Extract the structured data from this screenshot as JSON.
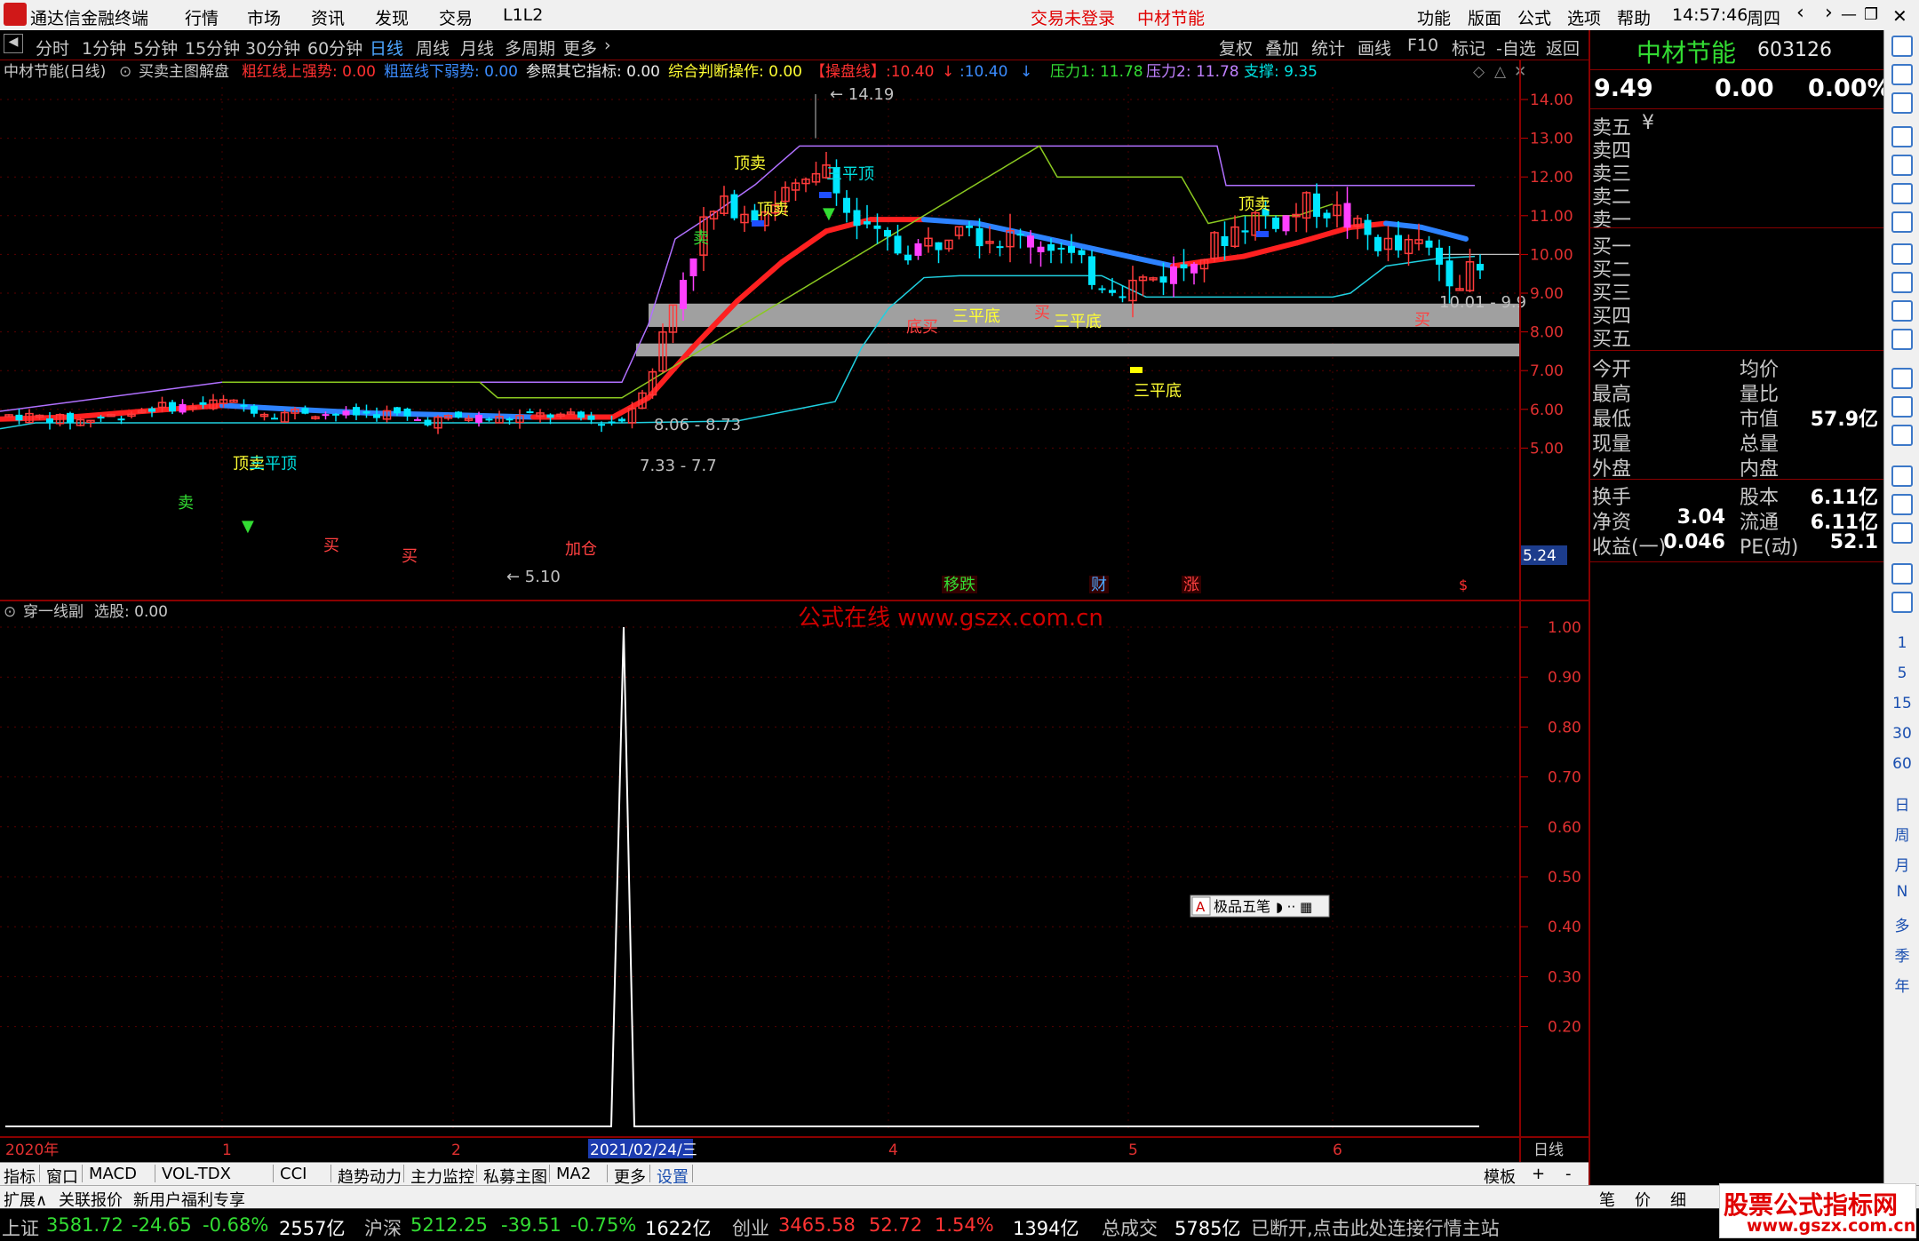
{
  "titlebar": {
    "app_name": "通达信金融终端",
    "menu": [
      "行情",
      "市场",
      "资讯",
      "发现",
      "交易",
      "L1L2"
    ],
    "trade_status": "交易未登录",
    "stock_name": "中材节能",
    "right_menu": [
      "功能",
      "版面",
      "公式",
      "选项",
      "帮助"
    ],
    "time": "14:57:46",
    "weekday": "周四"
  },
  "toolbar": {
    "periods": [
      "分时",
      "1分钟",
      "5分钟",
      "15分钟",
      "30分钟",
      "60分钟",
      "日线",
      "周线",
      "月线",
      "多周期",
      "更多"
    ],
    "active_period": "日线",
    "right_items": [
      "复权",
      "叠加",
      "统计",
      "画线",
      "F10",
      "标记",
      "-自选",
      "返回"
    ]
  },
  "main_panel": {
    "title": "中材节能(日线)",
    "indicator_name": "买卖主图解盘",
    "legend": [
      {
        "label": "粗红线上强势: 0.00",
        "color": "#ff3030"
      },
      {
        "label": "粗蓝线下弱势: 0.00",
        "color": "#3b8cff"
      },
      {
        "label": "参照其它指标: 0.00",
        "color": "#e8e8e8"
      },
      {
        "label": "综合判断操作: 0.00",
        "color": "#ffff33"
      },
      {
        "label": "【操盘线】:10.40",
        "color": "#ff3030"
      },
      {
        "label": ":10.40",
        "color": "#3b8cff"
      },
      {
        "label": "压力1: 11.78",
        "color": "#33dd33"
      },
      {
        "label": "压力2: 11.78",
        "color": "#c080ff"
      },
      {
        "label": "支撑: 9.35",
        "color": "#00e0e0"
      }
    ],
    "price_ticks": [
      "14.00",
      "13.00",
      "12.00",
      "11.00",
      "10.00",
      "9.00",
      "8.00",
      "7.00",
      "6.00",
      "5.00"
    ],
    "current_price_tag": "5.24",
    "annotations": {
      "high": "14.19",
      "low": "5.10",
      "zone1": "8.06 - 8.73",
      "zone2": "7.33 - 7.7",
      "right_zone": "10.01 - 9.9",
      "signals": [
        "顶卖",
        "三平顶",
        "顶卖",
        "顶卖",
        "三平顶",
        "顶卖",
        "卖",
        "卖",
        "买",
        "买",
        "加仓",
        "三平底",
        "三平底",
        "三平底",
        "底买",
        "买",
        "买"
      ],
      "events": [
        "移跌",
        "财",
        "涨"
      ]
    }
  },
  "sub_panel": {
    "title": "穿一线副",
    "value_label": "选股: 0.00",
    "ticks": [
      "1.00",
      "0.90",
      "0.80",
      "0.70",
      "0.60",
      "0.50",
      "0.40",
      "0.30",
      "0.20"
    ],
    "watermark_text": "公式在线 www.gszx.com.cn",
    "ime_bar": "极品五笔"
  },
  "x_axis": {
    "labels": [
      "2020年",
      "1",
      "2",
      "2021/02/24/三",
      "4",
      "5",
      "6"
    ],
    "period_label": "日线"
  },
  "chart_data": {
    "type": "candlestick",
    "title": "中材节能(日线)",
    "ylim": [
      5,
      14.5
    ],
    "high": 14.19,
    "low": 5.1,
    "resistance1": 11.78,
    "resistance2": 11.78,
    "support": 9.35,
    "operate_line": 10.4,
    "zones": [
      [
        8.06,
        8.73
      ],
      [
        7.33,
        7.7
      ]
    ],
    "sub_series": {
      "name": "选股",
      "ylim": [
        0,
        1
      ],
      "spike_index": "2021/02/24",
      "spike_value": 1.0
    }
  },
  "quote": {
    "name": "中材节能",
    "code": "603126",
    "price": "9.49",
    "change": "0.00",
    "pct": "0.00%",
    "sell": [
      "卖五",
      "卖四",
      "卖三",
      "卖二",
      "卖一"
    ],
    "sell_unit": "¥",
    "buy": [
      "买一",
      "买二",
      "买三",
      "买四",
      "买五"
    ],
    "info": [
      [
        "今开",
        "",
        "均价",
        ""
      ],
      [
        "最高",
        "",
        "量比",
        ""
      ],
      [
        "最低",
        "",
        "市值",
        "57.9亿"
      ],
      [
        "现量",
        "",
        "总量",
        ""
      ],
      [
        "外盘",
        "",
        "内盘",
        ""
      ]
    ],
    "info2": [
      [
        "换手",
        "",
        "股本",
        "6.11亿"
      ],
      [
        "净资",
        "3.04",
        "流通",
        "6.11亿"
      ],
      [
        "收益(一)",
        "0.046",
        "PE(动)",
        "52.1"
      ]
    ]
  },
  "bottom_tabs": [
    "指标",
    "窗口",
    "MACD",
    "VOL-TDX",
    "CCI",
    "趋势动力",
    "主力监控",
    "私募主图",
    "MA2",
    "更多",
    "设置"
  ],
  "bottom_right": [
    "模板",
    "+",
    "-"
  ],
  "bottom2": {
    "left": [
      "扩展∧",
      "关联报价",
      "新用户福利专享"
    ],
    "right": [
      "笔",
      "价",
      "细"
    ]
  },
  "statusbar": {
    "sh_label": "上证",
    "sh_val": "3581.72",
    "sh_chg": "-24.65",
    "sh_pct": "-0.68%",
    "sh_amt": "2557亿",
    "sz_label": "沪深",
    "sz_val": "5212.25",
    "sz_chg": "-39.51",
    "sz_pct": "-0.75%",
    "sz_amt": "1622亿",
    "cy_label": "创业",
    "cy_val": "3465.58",
    "cy_chg": "52.72",
    "cy_pct": "1.54%",
    "cy_amt": "1394亿",
    "total_label": "总成交",
    "total_val": "5785亿",
    "msg": "已断开,点击此处连接行情主站"
  },
  "site_watermark": {
    "line1": "股票公式指标网",
    "line2": "www.gszx.com.cn"
  }
}
